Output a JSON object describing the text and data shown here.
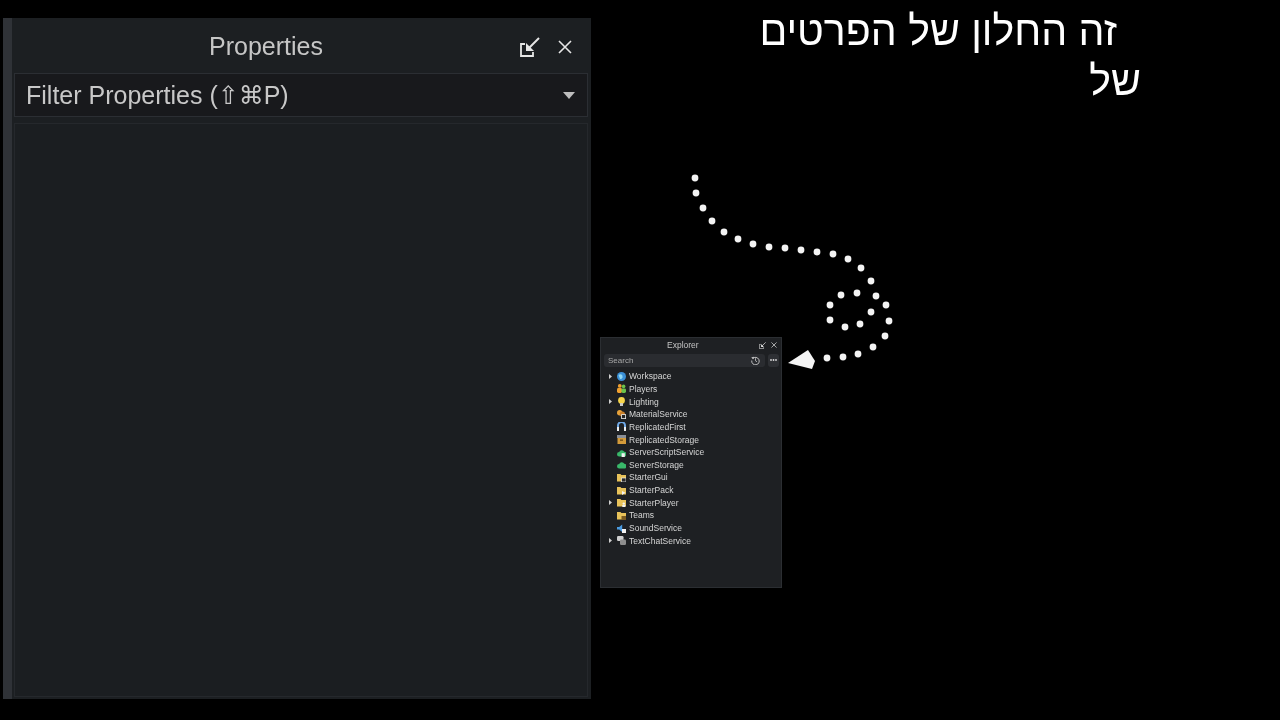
{
  "properties_panel": {
    "title": "Properties",
    "filter": {
      "placeholder": "Filter Properties (⇧⌘P)"
    }
  },
  "annotation": {
    "text": "זה החלון של הפרטים של"
  },
  "explorer": {
    "title": "Explorer",
    "search": {
      "placeholder": "Search"
    },
    "items": [
      {
        "label": "Workspace",
        "expandable": true
      },
      {
        "label": "Players",
        "expandable": false
      },
      {
        "label": "Lighting",
        "expandable": true
      },
      {
        "label": "MaterialService",
        "expandable": false
      },
      {
        "label": "ReplicatedFirst",
        "expandable": false
      },
      {
        "label": "ReplicatedStorage",
        "expandable": false
      },
      {
        "label": "ServerScriptService",
        "expandable": false
      },
      {
        "label": "ServerStorage",
        "expandable": false
      },
      {
        "label": "StarterGui",
        "expandable": false
      },
      {
        "label": "StarterPack",
        "expandable": false
      },
      {
        "label": "StarterPlayer",
        "expandable": true
      },
      {
        "label": "Teams",
        "expandable": false
      },
      {
        "label": "SoundService",
        "expandable": false
      },
      {
        "label": "TextChatService",
        "expandable": true
      }
    ]
  }
}
